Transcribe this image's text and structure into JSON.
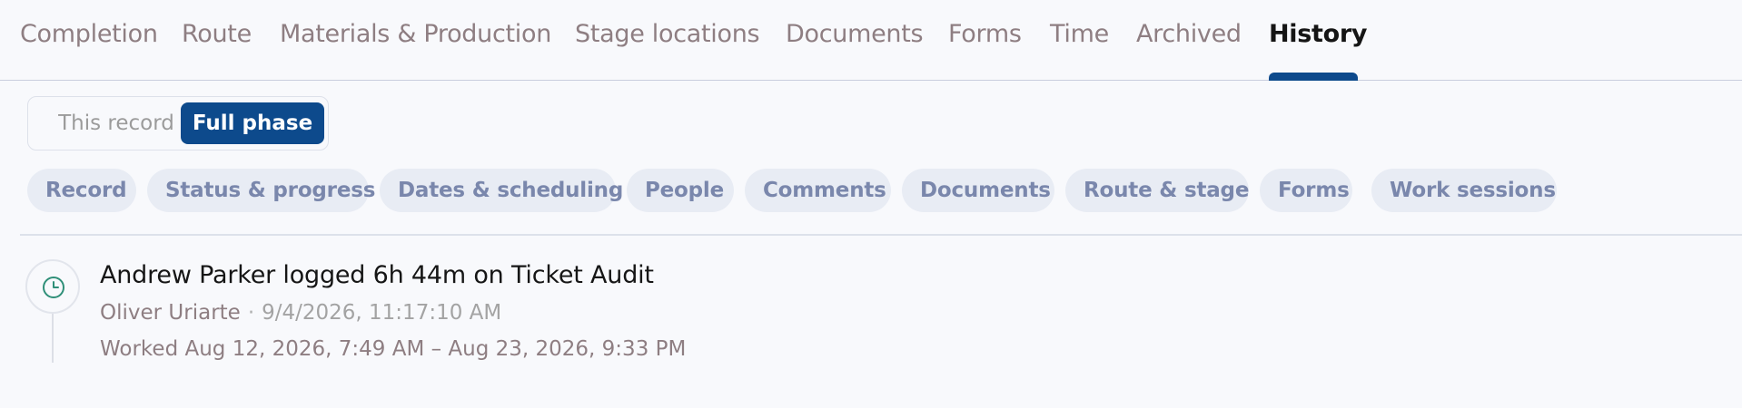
{
  "tabs": [
    {
      "label": "Completion",
      "active": false
    },
    {
      "label": "Route",
      "active": false
    },
    {
      "label": "Materials & Production",
      "active": false
    },
    {
      "label": "Stage locations",
      "active": false
    },
    {
      "label": "Documents",
      "active": false
    },
    {
      "label": "Forms",
      "active": false
    },
    {
      "label": "Time",
      "active": false
    },
    {
      "label": "Archived",
      "active": false
    },
    {
      "label": "History",
      "active": true
    }
  ],
  "scope_toggle": {
    "this_record": "This record",
    "full_phase": "Full phase",
    "selected": "Full phase"
  },
  "filters": [
    "Record",
    "Status & progress",
    "Dates & scheduling",
    "People",
    "Comments",
    "Documents",
    "Route & stage",
    "Forms",
    "Work sessions"
  ],
  "events": [
    {
      "icon": "clock-icon",
      "title": "Andrew Parker logged 6h 44m on Ticket Audit",
      "author": "Oliver Uriarte",
      "separator": "·",
      "timestamp": "9/4/2026, 11:17:10 AM",
      "detail": "Worked Aug 12, 2026, 7:49 AM – Aug 23, 2026, 9:33 PM"
    }
  ],
  "colors": {
    "accent": "#0d4a8c",
    "icon_green": "#2f8f78",
    "chip_text": "#7a87ac",
    "chip_bg": "#e8ecf4",
    "tab_inactive": "#8e7e82"
  }
}
